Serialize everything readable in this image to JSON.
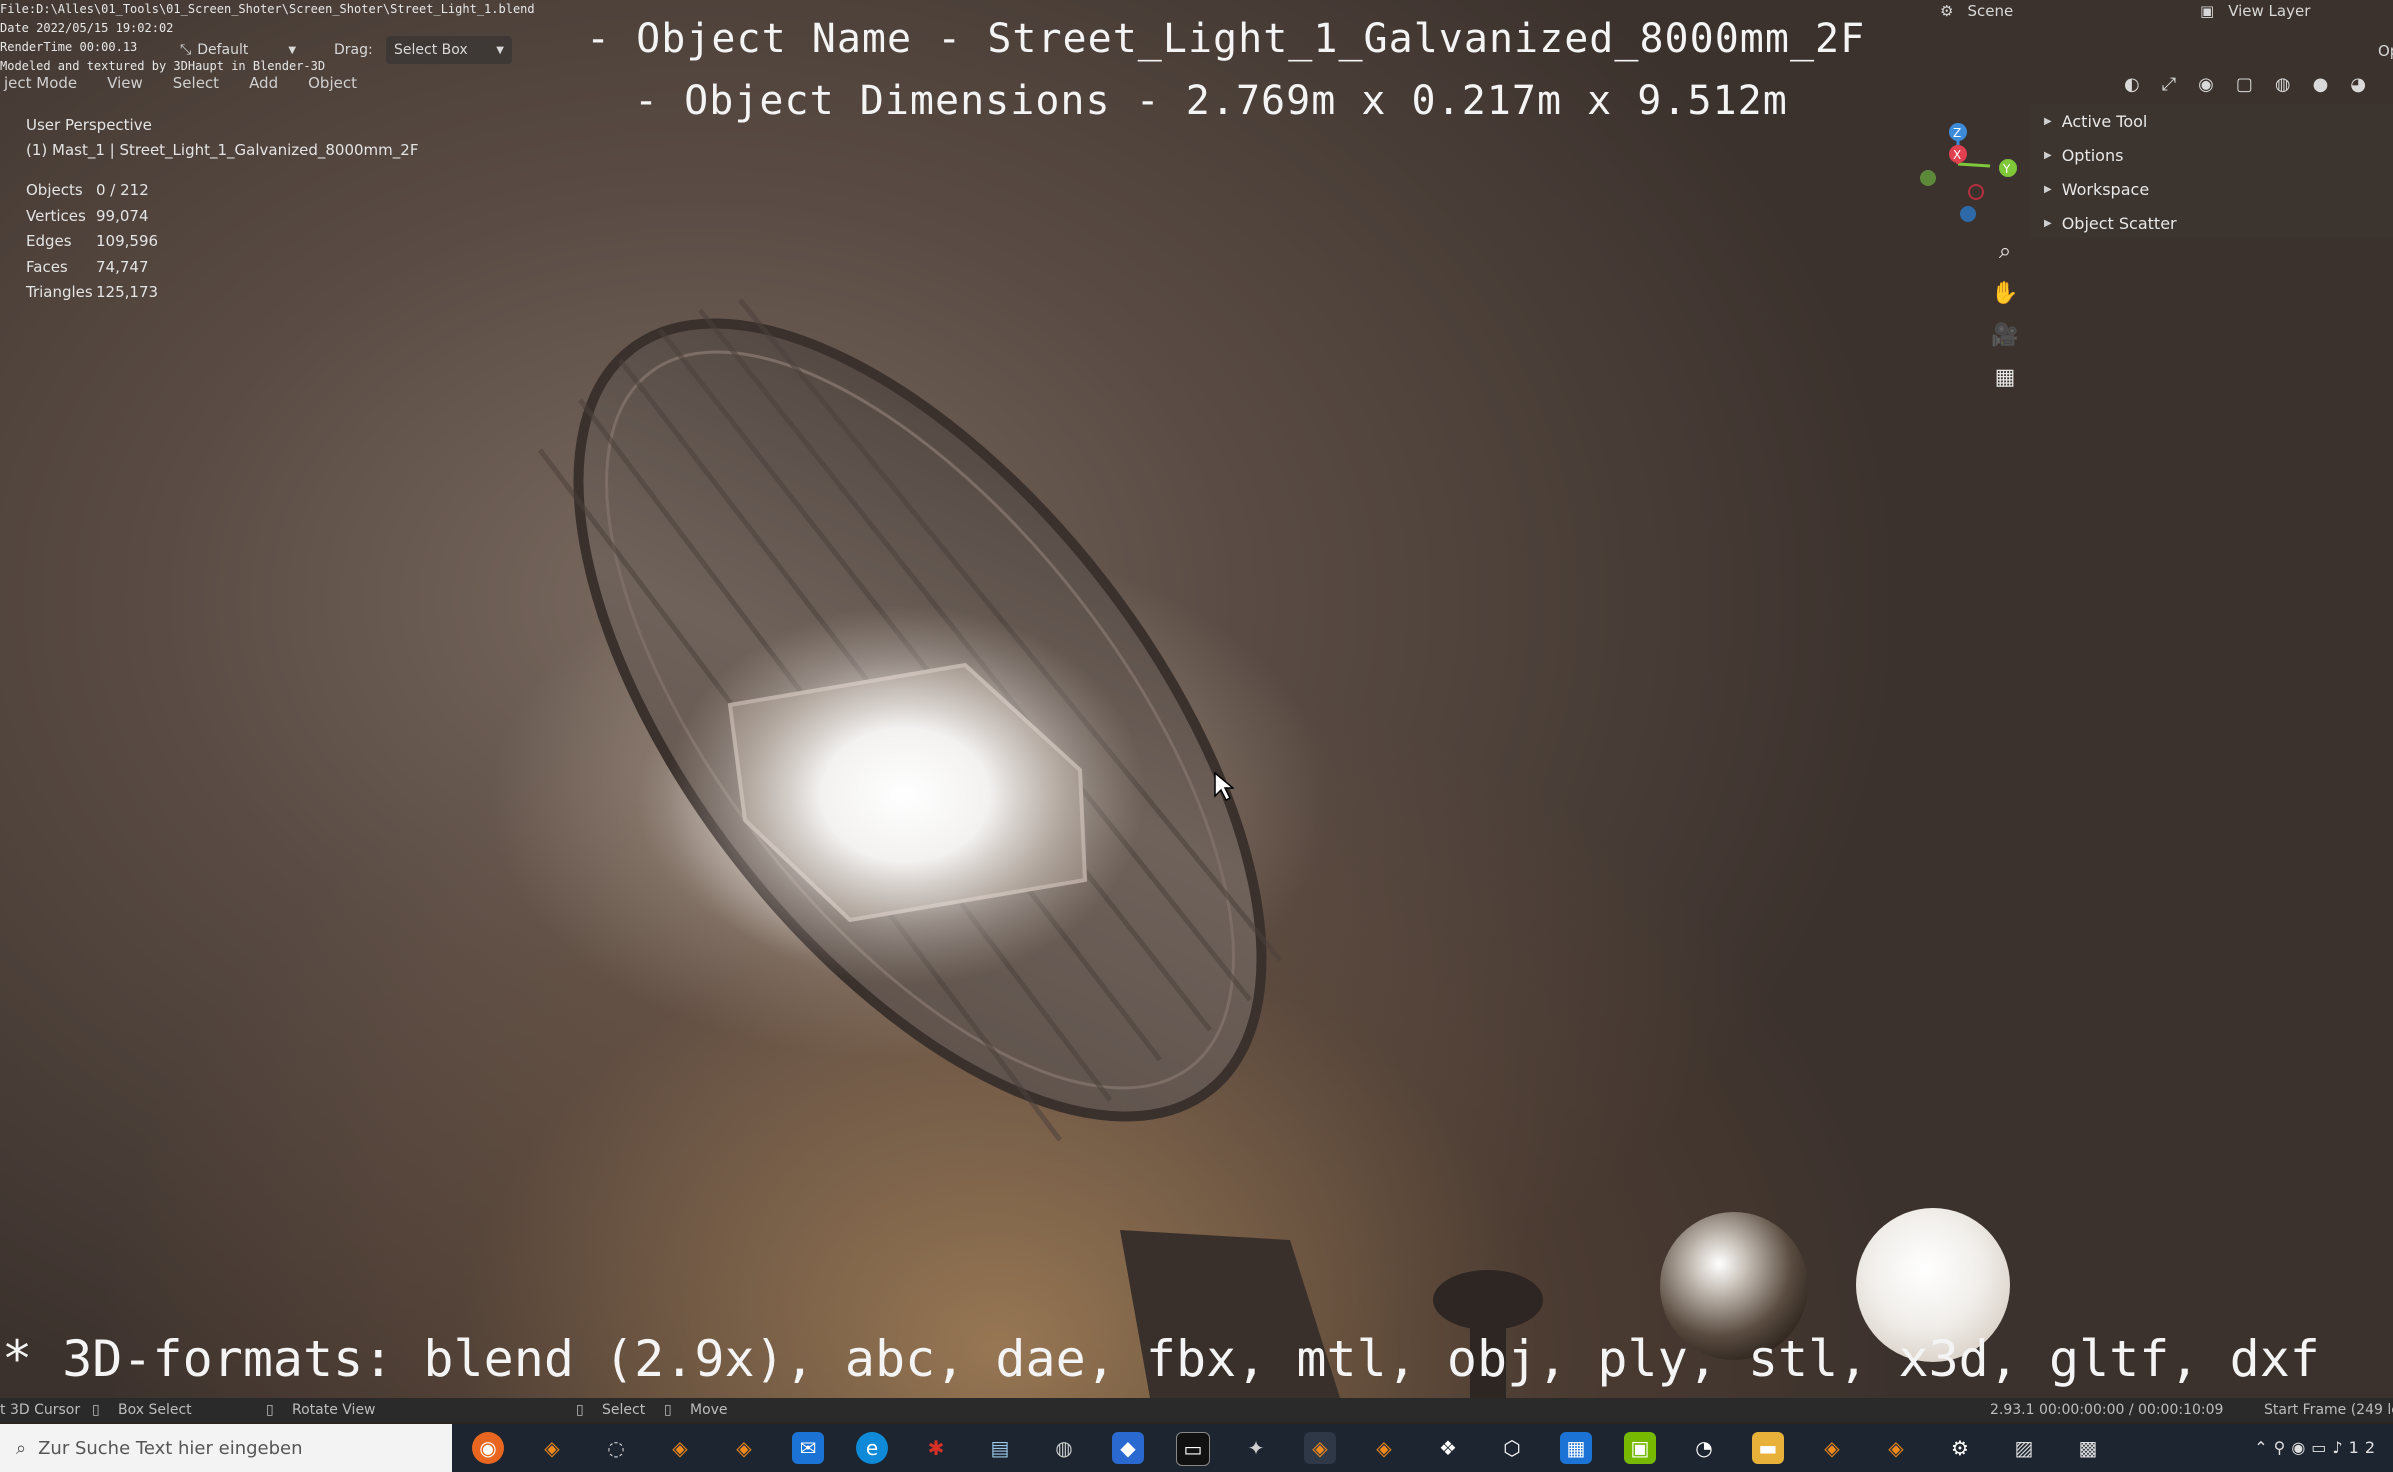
{
  "overlay": {
    "file_path": "File:D:\\Alles\\01_Tools\\01_Screen_Shoter\\Screen_Shoter\\Street_Light_1.blend",
    "date": "Date 2022/05/15 19:02:02",
    "render_time": "RenderTime 00:00.13",
    "credit": "Modeled and textured by 3DHaupt in Blender-3D",
    "object_name": "- Object Name - Street_Light_1_Galvanized_8000mm_2F",
    "object_dimensions": "- Object Dimensions -  2.769m x 0.217m x 9.512m",
    "formats": "* 3D-formats: blend (2.9x), abc, dae, fbx, mtl, obj, ply, stl, x3d, gltf, dxf"
  },
  "header": {
    "orientation_value": "Default",
    "drag_label": "Drag:",
    "drag_value": "Select Box",
    "mode": "ject Mode",
    "menu": [
      "View",
      "Select",
      "Add",
      "Object"
    ],
    "scene": "Scene",
    "view_layer": "View Layer",
    "options_stub": "Op"
  },
  "viewport_info": {
    "perspective": "User Perspective",
    "active": "(1) Mast_1 | Street_Light_1_Galvanized_8000mm_2F",
    "stats": [
      {
        "key": "Objects",
        "value": "0 / 212"
      },
      {
        "key": "Vertices",
        "value": "99,074"
      },
      {
        "key": "Edges",
        "value": "109,596"
      },
      {
        "key": "Faces",
        "value": "74,747"
      },
      {
        "key": "Triangles",
        "value": "125,173"
      }
    ]
  },
  "gizmo": {
    "x": "X",
    "y": "Y",
    "z": "Z"
  },
  "sidebar": {
    "items": [
      "Active Tool",
      "Options",
      "Workspace",
      "Object Scatter"
    ]
  },
  "statusbar": {
    "cursor": "t 3D Cursor",
    "box_select": "Box Select",
    "rotate": "Rotate View",
    "select": "Select",
    "move": "Move",
    "version_time": "2.93.1  00:00:00:00 / 00:00:10:09",
    "start_frame": "Start Frame (249 le"
  },
  "taskbar": {
    "search_placeholder": "Zur Suche Text hier eingeben",
    "clock": "12"
  },
  "colors": {
    "taskbar_bg": "#1d2530",
    "search_bg": "#f3f3f3",
    "gizmo_x": "#e0404f",
    "gizmo_y": "#7fc83a",
    "gizmo_z": "#3b8bd9"
  }
}
